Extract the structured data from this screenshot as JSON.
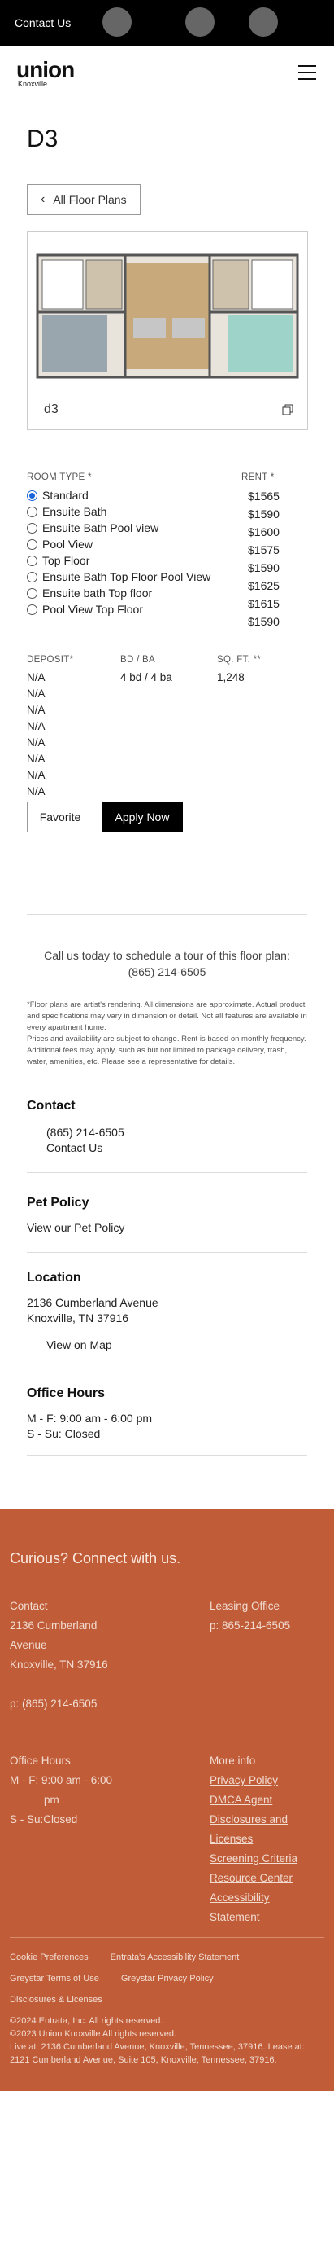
{
  "topbar": {
    "contact_label": "Contact Us"
  },
  "header": {
    "logo_main": "union",
    "logo_sub": "Knoxville"
  },
  "page": {
    "title": "D3",
    "back_label": "All Floor Plans",
    "plan_name": "d3"
  },
  "room_types": {
    "header": "ROOM TYPE *",
    "rent_header": "RENT *",
    "options": [
      {
        "label": "Standard",
        "rent": "$1565",
        "selected": true
      },
      {
        "label": "Ensuite Bath",
        "rent": "$1590",
        "selected": false
      },
      {
        "label": "Ensuite Bath Pool view",
        "rent": "$1600",
        "selected": false
      },
      {
        "label": "Pool View",
        "rent": "$1575",
        "selected": false
      },
      {
        "label": "Top Floor",
        "rent": "$1590",
        "selected": false
      },
      {
        "label": "Ensuite Bath Top Floor Pool View",
        "rent": "$1625",
        "selected": false
      },
      {
        "label": "Ensuite bath Top floor",
        "rent": "$1615",
        "selected": false
      },
      {
        "label": "Pool View Top Floor",
        "rent": "$1590",
        "selected": false
      }
    ]
  },
  "details": {
    "deposit_header": "DEPOSIT*",
    "bdba_header": "BD / BA",
    "sqft_header": "SQ. FT. **",
    "deposits": [
      "N/A",
      "N/A",
      "N/A",
      "N/A",
      "N/A",
      "N/A",
      "N/A",
      "N/A"
    ],
    "bdba": "4 bd / 4 ba",
    "sqft": "1,248"
  },
  "actions": {
    "favorite": "Favorite",
    "apply": "Apply Now"
  },
  "call": {
    "line1": "Call us today to schedule a tour of this floor plan:",
    "phone": "(865) 214-6505"
  },
  "disclaimer": {
    "p1": "*Floor plans are artist's rendering. All dimensions are approximate. Actual product and specifications may vary in dimension or detail. Not all features are available in every apartment home.",
    "p2": "Prices and availability are subject to change. Rent is based on monthly frequency. Additional fees may apply, such as but not limited to package delivery, trash, water, amenities, etc. Please see a representative for details."
  },
  "contact": {
    "title": "Contact",
    "phone": "(865) 214-6505",
    "link": "Contact Us"
  },
  "pet": {
    "title": "Pet Policy",
    "link": "View our Pet Policy"
  },
  "location": {
    "title": "Location",
    "line1": "2136 Cumberland Avenue",
    "line2": "Knoxville, TN 37916",
    "map": "View on Map"
  },
  "office": {
    "title": "Office Hours",
    "weekday": "M - F:  9:00 am - 6:00 pm",
    "weekend": "S - Su:  Closed"
  },
  "footer": {
    "curious": "Curious? Connect with us.",
    "contact_title": "Contact",
    "addr1": "2136 Cumberland",
    "addr2": "Avenue",
    "addr3": "Knoxville, TN 37916",
    "phone": "p: (865) 214-6505",
    "leasing_title": "Leasing Office",
    "leasing_phone": "p: 865-214-6505",
    "hours_title": "Office Hours",
    "hours1": "M - F: 9:00 am - 6:00",
    "hours2": "pm",
    "hours3": "S - Su:Closed",
    "more_title": "More info",
    "more_links": [
      "Privacy Policy",
      "DMCA Agent",
      "Disclosures and",
      "Licenses",
      "Screening Criteria",
      "Resource Center",
      "Accessibility",
      "Statement"
    ],
    "links": [
      "Cookie Preferences",
      "Entrata's Accessibility Statement",
      "Greystar Terms of Use",
      "Greystar Privacy Policy",
      "Disclosures & Licenses"
    ],
    "copy1": "©2024 Entrata, Inc. All rights reserved.",
    "copy2": "©2023 Union Knoxville All rights reserved.",
    "copy3": "Live at: 2136 Cumberland Avenue, Knoxville, Tennessee, 37916. Lease at: 2121 Cumberland Avenue, Suite 105, Knoxville, Tennessee, 37916."
  }
}
